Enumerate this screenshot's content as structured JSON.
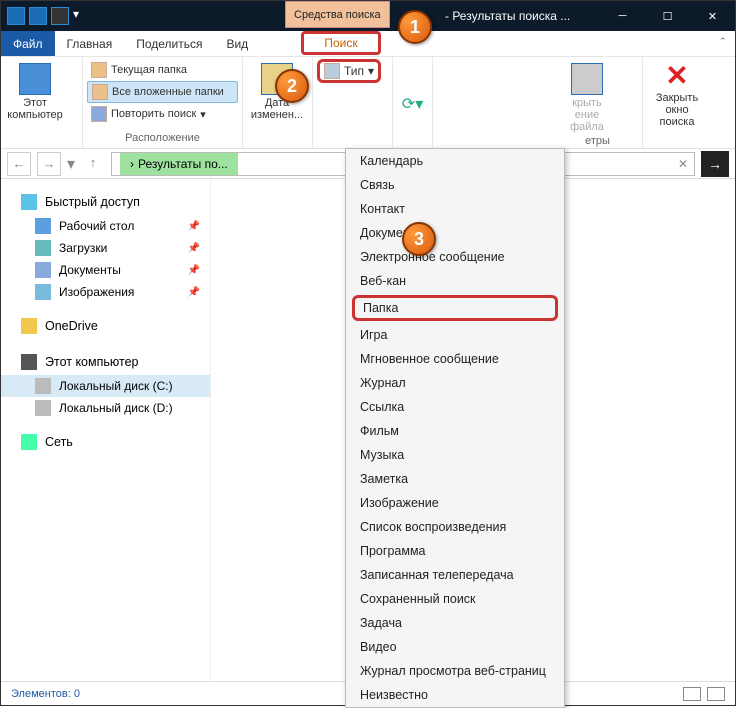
{
  "titlebar": {
    "search_tools": "Средства поиска",
    "window_title": "- Результаты поиска ..."
  },
  "callouts": {
    "c1": "1",
    "c2": "2",
    "c3": "3"
  },
  "menubar": {
    "file": "Файл",
    "home": "Главная",
    "share": "Поделиться",
    "view": "Вид",
    "search": "Поиск"
  },
  "ribbon": {
    "this_pc": "Этот\nкомпьютер",
    "current_folder": "Текущая папка",
    "all_subfolders": "Все вложенные папки",
    "repeat_search": "Повторить поиск",
    "location_label": "Расположение",
    "date_changed": "Дата\nизменен...",
    "type": "Тип",
    "close_save": "крыть\nение файла",
    "close_save_label": "етры",
    "close_search": "Закрыть\nокно поиска"
  },
  "address": {
    "breadcrumb": "Результаты по..."
  },
  "nav": {
    "quick": "Быстрый доступ",
    "desktop": "Рабочий стол",
    "downloads": "Загрузки",
    "documents": "Документы",
    "pictures": "Изображения",
    "onedrive": "OneDrive",
    "thispc": "Этот компьютер",
    "drivec": "Локальный диск (C:)",
    "drived": "Локальный диск (D:)",
    "network": "Сеть"
  },
  "dropdown": {
    "items": [
      "Календарь",
      "Связь",
      "Контакт",
      "Документ",
      "Электронное сообщение",
      "Веб-кан",
      "Папка",
      "Игра",
      "Мгновенное сообщение",
      "Журнал",
      "Ссылка",
      "Фильм",
      "Музыка",
      "Заметка",
      "Изображение",
      "Список воспроизведения",
      "Программа",
      "Записанная телепередача",
      "Сохраненный поиск",
      "Задача",
      "Видео",
      "Журнал просмотра веб-страниц",
      "Неизвестно"
    ]
  },
  "status": {
    "elements": "Элементов: 0"
  }
}
